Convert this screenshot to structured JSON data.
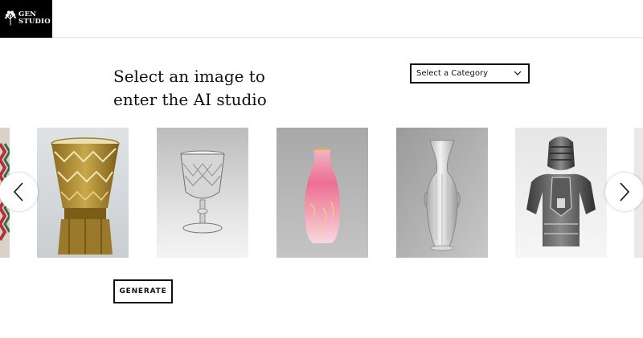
{
  "logo": {
    "line1": "GEN",
    "line2": "STUDIO",
    "icon": "tree-icon"
  },
  "headline": {
    "line1": "Select an image to",
    "line2": "enter the AI studio"
  },
  "category_select": {
    "selected": "Select a Category",
    "icon": "chevron-down-icon"
  },
  "carousel": {
    "prev_icon": "chevron-left-icon",
    "next_icon": "chevron-right-icon",
    "items": [
      {
        "name": "amber-glass-beaker"
      },
      {
        "name": "cut-glass-goblet"
      },
      {
        "name": "pink-satin-glass-vase"
      },
      {
        "name": "white-porcelain-vase"
      },
      {
        "name": "suit-of-armor"
      }
    ]
  },
  "generate_label": "GENERATE",
  "colors": {
    "text": "#111111",
    "logo_bg": "#000000",
    "accent_link": "#3b5bdb",
    "border": "#111111"
  }
}
